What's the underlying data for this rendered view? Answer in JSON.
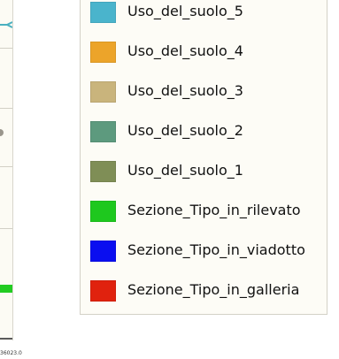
{
  "map": {
    "coordinate_fragment": "36023.0",
    "mark_colors": {
      "teal": "#4ab0c0",
      "green": "#22cc22"
    }
  },
  "legend": {
    "items": [
      {
        "label": "Uso_del_suolo_5",
        "color": "#4ab4cc"
      },
      {
        "label": "Uso_del_suolo_4",
        "color": "#eca42a"
      },
      {
        "label": "Uso_del_suolo_3",
        "color": "#c9b47c"
      },
      {
        "label": "Uso_del_suolo_2",
        "color": "#5d9a7e"
      },
      {
        "label": "Uso_del_suolo_1",
        "color": "#7f8e56"
      },
      {
        "label": "Sezione_Tipo_in_rilevato",
        "color": "#1ec81e"
      },
      {
        "label": "Sezione_Tipo_in_viadotto",
        "color": "#0a0ef0"
      },
      {
        "label": "Sezione_Tipo_in_galleria",
        "color": "#e0220e"
      }
    ]
  }
}
